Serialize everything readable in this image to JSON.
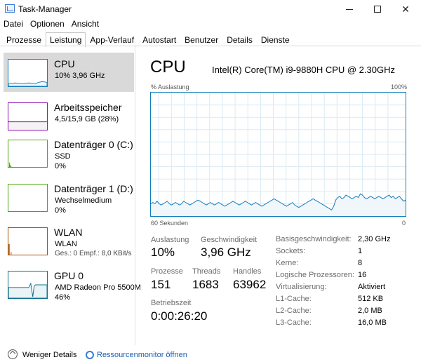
{
  "window": {
    "title": "Task-Manager"
  },
  "menu": [
    "Datei",
    "Optionen",
    "Ansicht"
  ],
  "tabs": [
    "Prozesse",
    "Leistung",
    "App-Verlauf",
    "Autostart",
    "Benutzer",
    "Details",
    "Dienste"
  ],
  "active_tab": "Leistung",
  "sidebar": [
    {
      "title": "CPU",
      "sub": "10%  3,96 GHz",
      "sub2": "",
      "color": "#117dbb"
    },
    {
      "title": "Arbeitsspeicher",
      "sub": "4,5/15,9 GB (28%)",
      "sub2": "",
      "color": "#8b12ae"
    },
    {
      "title": "Datenträger 0 (C:)",
      "sub": "SSD",
      "sub2": "0%",
      "color": "#4da60c"
    },
    {
      "title": "Datenträger 1 (D:)",
      "sub": "Wechselmedium",
      "sub2": "0%",
      "color": "#4da60c"
    },
    {
      "title": "WLAN",
      "sub": "WLAN",
      "sub2": "Ges.: 0  Empf.: 8,0 KBit/s",
      "color": "#a74f01"
    },
    {
      "title": "GPU 0",
      "sub": "AMD Radeon Pro 5500M",
      "sub2": "46%",
      "color": "#0e6f8e"
    }
  ],
  "main": {
    "title": "CPU",
    "model": "Intel(R) Core(TM) i9-9880H CPU @ 2.30GHz",
    "graph_label_left": "% Auslastung",
    "graph_label_right": "100%",
    "graph_foot_left": "60 Sekunden",
    "graph_foot_right": "0",
    "graph_color": "#117dbb",
    "usage_series": [
      10,
      11,
      10,
      12,
      10,
      9,
      10,
      11,
      12,
      10,
      9,
      10,
      11,
      10,
      9,
      10,
      12,
      11,
      10,
      9,
      10,
      11,
      12,
      13,
      12,
      11,
      10,
      9,
      10,
      11,
      10,
      9,
      10,
      11,
      10,
      9,
      8,
      9,
      10,
      11,
      12,
      11,
      10,
      9,
      10,
      11,
      12,
      11,
      10,
      9,
      10,
      11,
      10,
      9,
      8,
      9,
      10,
      11,
      12,
      13,
      14,
      13,
      12,
      11,
      10,
      9,
      8,
      9,
      10,
      11,
      9,
      8,
      7,
      8,
      9,
      10,
      11,
      12,
      13,
      14,
      13,
      12,
      11,
      10,
      9,
      8,
      7,
      6,
      5,
      8,
      13,
      15,
      16,
      14,
      15,
      17,
      16,
      15,
      14,
      15,
      16,
      15,
      18,
      17,
      15,
      14,
      15,
      16,
      15,
      14,
      15,
      16,
      15,
      14,
      15,
      16,
      17,
      15,
      16,
      14,
      15,
      16,
      14,
      12,
      13
    ],
    "stats": {
      "auslastung_label": "Auslastung",
      "auslastung_value": "10%",
      "geschwindigkeit_label": "Geschwindigkeit",
      "geschwindigkeit_value": "3,96 GHz",
      "prozesse_label": "Prozesse",
      "prozesse_value": "151",
      "threads_label": "Threads",
      "threads_value": "1683",
      "handles_label": "Handles",
      "handles_value": "63962",
      "betriebszeit_label": "Betriebszeit",
      "betriebszeit_value": "0:00:26:20"
    },
    "info": [
      {
        "label": "Basisgeschwindigkeit:",
        "value": "2,30 GHz"
      },
      {
        "label": "Sockets:",
        "value": "1"
      },
      {
        "label": "Kerne:",
        "value": "8"
      },
      {
        "label": "Logische Prozessoren:",
        "value": "16"
      },
      {
        "label": "Virtualisierung:",
        "value": "Aktiviert"
      },
      {
        "label": "L1-Cache:",
        "value": "512 KB"
      },
      {
        "label": "L2-Cache:",
        "value": "2,0 MB"
      },
      {
        "label": "L3-Cache:",
        "value": "16,0 MB"
      }
    ]
  },
  "footer": {
    "less_details": "Weniger Details",
    "resource_monitor": "Ressourcenmonitor öffnen"
  }
}
